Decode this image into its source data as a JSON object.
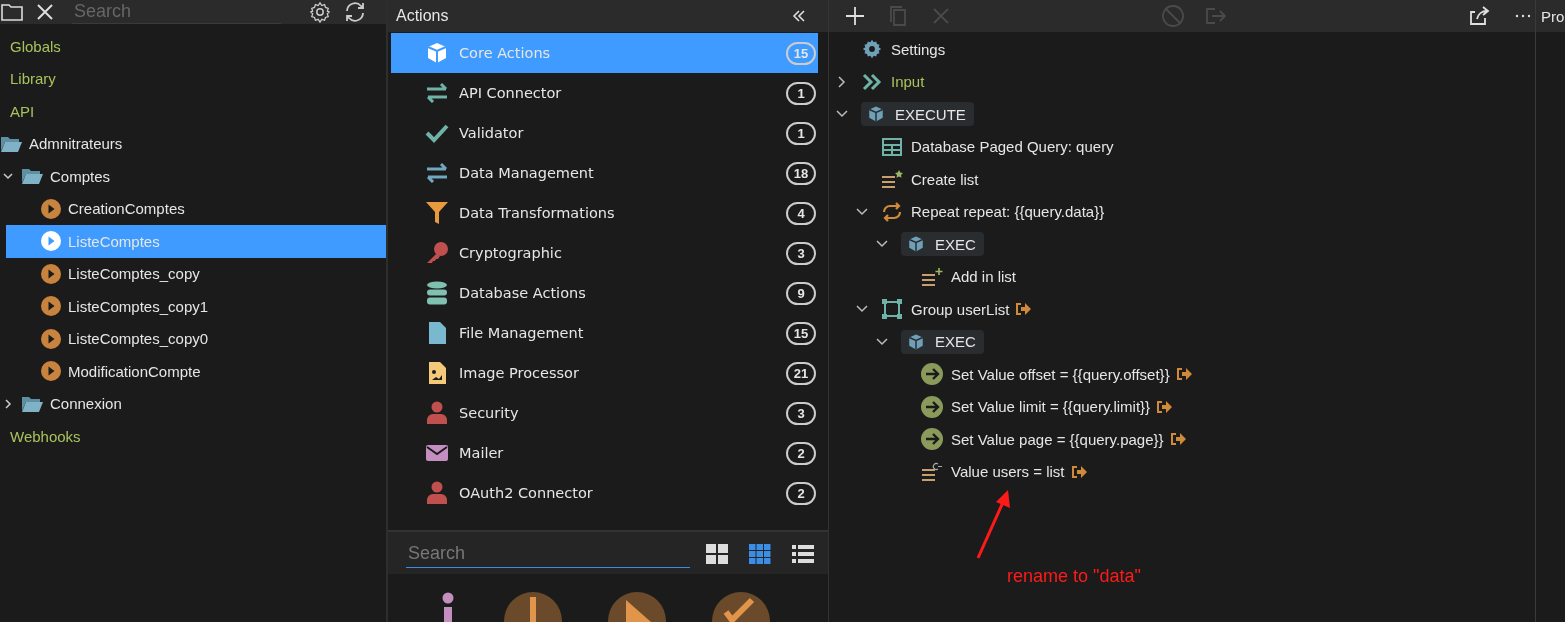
{
  "explorer": {
    "search": {
      "placeholder": "Search"
    },
    "tree": [
      {
        "kind": "root",
        "label": "Globals"
      },
      {
        "kind": "root",
        "label": "Library"
      },
      {
        "kind": "root",
        "label": "API"
      },
      {
        "kind": "folder",
        "label": "Admnitrateurs",
        "children": [
          {
            "kind": "folder",
            "label": "Comptes",
            "expanded": true,
            "children": [
              {
                "kind": "action",
                "label": "CreationComptes",
                "selected": false
              },
              {
                "kind": "action",
                "label": "ListeComptes",
                "selected": true
              },
              {
                "kind": "action",
                "label": "ListeComptes_copy",
                "selected": false
              },
              {
                "kind": "action",
                "label": "ListeComptes_copy1",
                "selected": false
              },
              {
                "kind": "action",
                "label": "ListeComptes_copy0",
                "selected": false
              },
              {
                "kind": "action",
                "label": "ModificationCompte",
                "selected": false
              }
            ]
          },
          {
            "kind": "folder",
            "label": "Connexion",
            "expanded": false
          }
        ]
      },
      {
        "kind": "root",
        "label": "Webhooks"
      }
    ]
  },
  "actions_panel": {
    "title": "Actions",
    "categories": [
      {
        "label": "Core Actions",
        "count": "15",
        "selected": true
      },
      {
        "label": "API Connector",
        "count": "1",
        "selected": false
      },
      {
        "label": "Validator",
        "count": "1",
        "selected": false
      },
      {
        "label": "Data Management",
        "count": "18",
        "selected": false
      },
      {
        "label": "Data Transformations",
        "count": "4",
        "selected": false
      },
      {
        "label": "Cryptographic",
        "count": "3",
        "selected": false
      },
      {
        "label": "Database Actions",
        "count": "9",
        "selected": false
      },
      {
        "label": "File Management",
        "count": "15",
        "selected": false
      },
      {
        "label": "Image Processor",
        "count": "21",
        "selected": false
      },
      {
        "label": "Security",
        "count": "3",
        "selected": false
      },
      {
        "label": "Mailer",
        "count": "2",
        "selected": false
      },
      {
        "label": "OAuth2 Connector",
        "count": "2",
        "selected": false
      }
    ],
    "search": {
      "placeholder": "Search"
    },
    "view_modes": [
      {
        "selected": false
      },
      {
        "selected": true
      },
      {
        "selected": false
      }
    ]
  },
  "flow_editor": {
    "toolbar": [
      {
        "disabled": false
      },
      {
        "disabled": true
      },
      {
        "disabled": true
      },
      {
        "disabled": true
      },
      {
        "disabled": true
      },
      {
        "disabled": false
      },
      {
        "disabled": false
      }
    ],
    "steps": [
      {
        "kind": "settings",
        "label": "Settings"
      },
      {
        "kind": "input",
        "label": "Input",
        "expanded": false
      },
      {
        "kind": "exec",
        "label": "EXECUTE",
        "expanded": true,
        "children": [
          {
            "kind": "query",
            "label": "Database Paged Query: query"
          },
          {
            "kind": "create-list",
            "label": "Create list"
          },
          {
            "kind": "repeat",
            "label": "Repeat repeat: {{query.data}}",
            "expanded": true,
            "children": [
              {
                "kind": "exec",
                "label": "EXEC",
                "expanded": true,
                "children": [
                  {
                    "kind": "add-list",
                    "label": "Add in list"
                  }
                ]
              }
            ]
          },
          {
            "kind": "group",
            "label": "Group userList",
            "expanded": true,
            "output": true,
            "children": [
              {
                "kind": "exec",
                "label": "EXEC",
                "expanded": true,
                "children": [
                  {
                    "kind": "set-value",
                    "label": "Set Value offset = {{query.offset}}",
                    "output": true
                  },
                  {
                    "kind": "set-value",
                    "label": "Set Value limit = {{query.limit}}",
                    "output": true
                  },
                  {
                    "kind": "set-value",
                    "label": "Set Value page = {{query.page}}",
                    "output": true
                  },
                  {
                    "kind": "value",
                    "label": "Value users = list",
                    "output": true
                  }
                ]
              }
            ]
          }
        ]
      }
    ],
    "annotation": {
      "text": "rename to \"data\""
    }
  },
  "properties_panel": {
    "title": "Pro"
  }
}
